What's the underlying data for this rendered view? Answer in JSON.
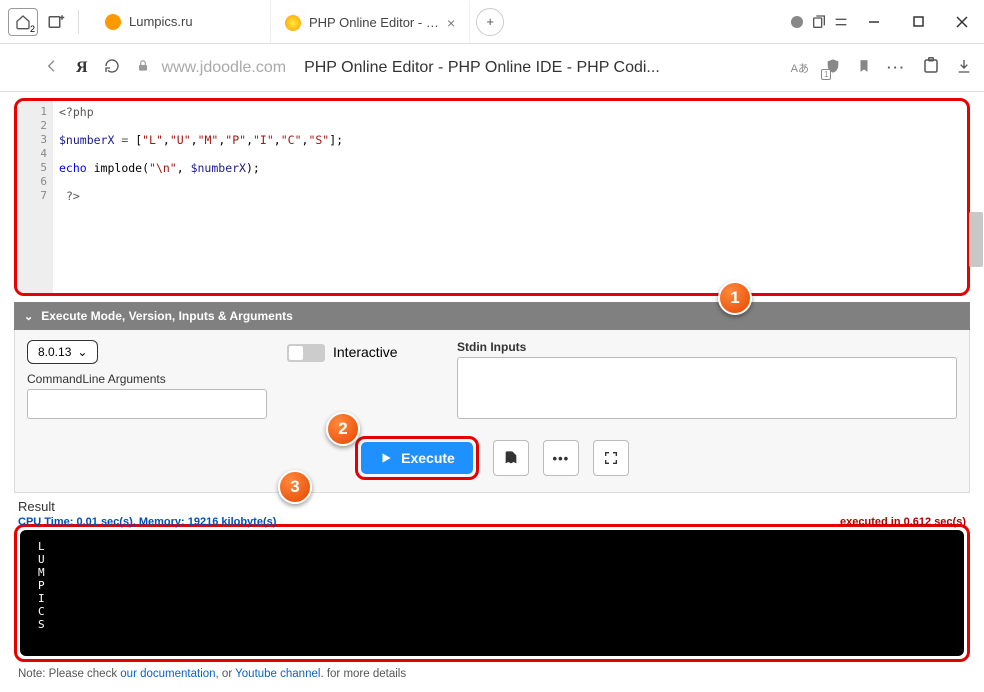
{
  "titlebar": {
    "home_badge": "2",
    "tabs": [
      {
        "title": "Lumpics.ru",
        "ico_color": "#ff9900"
      },
      {
        "title": "PHP Online Editor - PHP",
        "ico_color": "#ffb000",
        "active": true
      }
    ]
  },
  "addressbar": {
    "domain": "www.jdoodle.com",
    "title": "PHP Online Editor - PHP Online IDE - PHP Codi...",
    "lang_ico": "Aあ",
    "shield_badge": "1"
  },
  "editor": {
    "line_count": 7,
    "code_plain": "<?php\n\n$numberX = [\"L\",\"U\",\"M\",\"P\",\"I\",\"C\",\"S\"];\n\necho implode(\"\\n\", $numberX);\n\n ?>"
  },
  "exec_panel": {
    "header": "Execute Mode, Version, Inputs & Arguments",
    "version": "8.0.13",
    "interactive_label": "Interactive",
    "cmd_args_label": "CommandLine Arguments",
    "cmd_args_value": "",
    "stdin_label": "Stdin Inputs",
    "stdin_value": ""
  },
  "buttons": {
    "execute": "Execute"
  },
  "result": {
    "label": "Result",
    "cpu_mem": "CPU Time: 0.01 sec(s), Memory: 19216 kilobyte(s)",
    "exec_time": "executed in 0.612 sec(s)",
    "output": "L\nU\nM\nP\nI\nC\nS"
  },
  "note": {
    "prefix": "Note: Please check ",
    "link1": "our documentation",
    "mid": ", or ",
    "link2": "Youtube channel",
    "suffix": ". for more details"
  },
  "steps": {
    "s1": "1",
    "s2": "2",
    "s3": "3"
  }
}
